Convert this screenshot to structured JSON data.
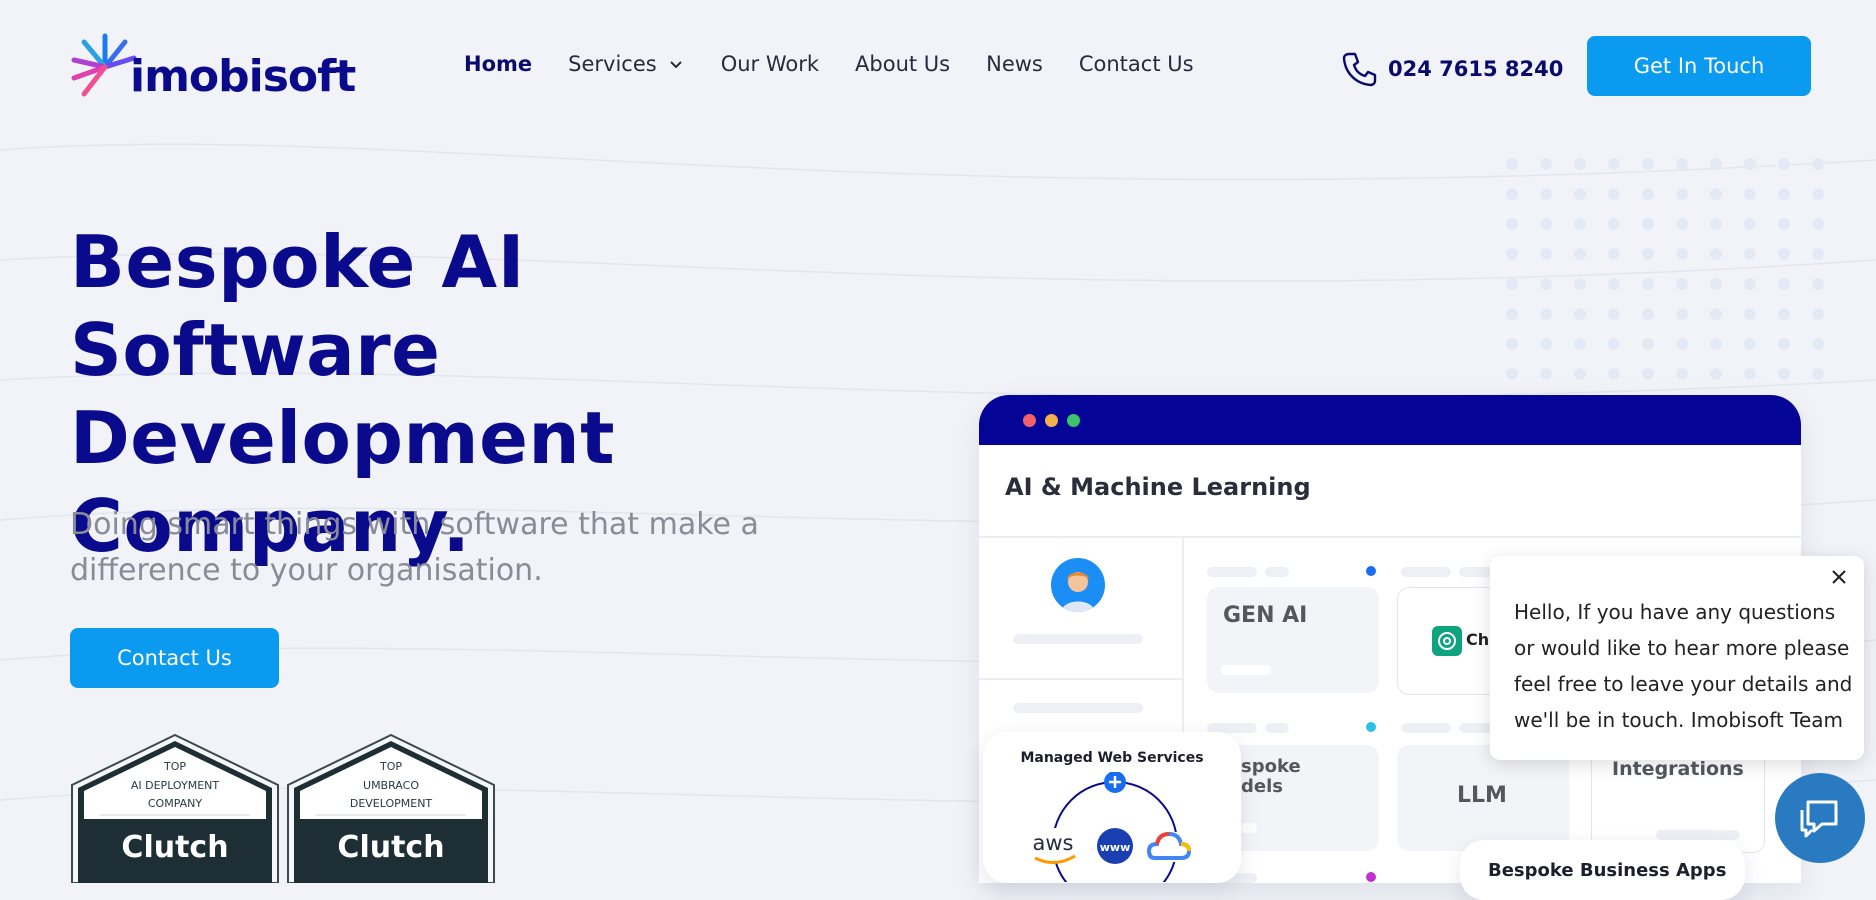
{
  "header": {
    "logo_text": "imobisoft",
    "nav": [
      {
        "label": "Home",
        "active": true
      },
      {
        "label": "Services",
        "has_dropdown": true
      },
      {
        "label": "Our Work"
      },
      {
        "label": "About Us"
      },
      {
        "label": "News"
      },
      {
        "label": "Contact Us"
      }
    ],
    "phone": "024 7615 8240",
    "cta_label": "Get In Touch"
  },
  "hero": {
    "title_lines": [
      "Bespoke AI Software",
      "Development",
      "Company."
    ],
    "subtitle_lines": [
      "Doing smart things with software that make a",
      "difference to your organisation."
    ],
    "button_label": "Contact Us"
  },
  "badges": [
    {
      "line1": "TOP",
      "line2": "AI DEPLOYMENT",
      "line3": "COMPANY",
      "brand": "Clutch"
    },
    {
      "line1": "TOP",
      "line2": "UMBRACO",
      "line3": "DEVELOPMENT",
      "brand": "Clutch"
    }
  ],
  "mockup": {
    "title": "AI & Machine Learning",
    "cards": {
      "gen_ai": "GEN AI",
      "chat": "Ch",
      "models": "spoke\ndels",
      "llm": "LLM",
      "integrations": "Integrations"
    },
    "managed_title": "Managed Web Services",
    "managed_aws": "aws",
    "managed_www": "www",
    "bespoke_title": "Bespoke Business Apps"
  },
  "chat": {
    "message": "Hello, If you have any questions or would like to hear more please feel free to leave your details and we'll be in touch. Imobisoft Team"
  },
  "colors": {
    "brand_navy": "#0a0a8c",
    "accent_blue": "#0a9af0",
    "window_bar": "#040497",
    "chat_bubble": "#2a7ac2"
  }
}
